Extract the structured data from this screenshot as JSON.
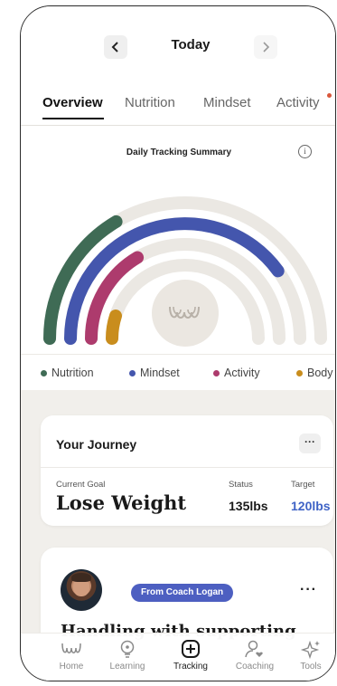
{
  "date_nav": {
    "title": "Today",
    "prev_icon": "chevron-left",
    "next_icon": "chevron-right"
  },
  "tabs": [
    {
      "label": "Overview",
      "active": true
    },
    {
      "label": "Nutrition",
      "active": false
    },
    {
      "label": "Mindset",
      "active": false
    },
    {
      "label": "Activity",
      "active": false,
      "notification_dot": true
    }
  ],
  "summary": {
    "title": "Daily Tracking Summary",
    "info_icon": "info-icon",
    "rings": [
      {
        "name": "Nutrition",
        "color": "#3f6b55",
        "progress": 0.33
      },
      {
        "name": "Mindset",
        "color": "#4456ad",
        "progress": 0.8
      },
      {
        "name": "Activity",
        "color": "#ad3b6d",
        "progress": 0.33
      },
      {
        "name": "Body",
        "color": "#c98d1d",
        "progress": 0.1
      }
    ],
    "track_color": "#ebe8e3",
    "legend": [
      {
        "label": "Nutrition",
        "color": "#3f6b55"
      },
      {
        "label": "Mindset",
        "color": "#4456ad"
      },
      {
        "label": "Activity",
        "color": "#ad3b6d"
      },
      {
        "label": "Body",
        "color": "#c98d1d"
      }
    ]
  },
  "journey": {
    "title": "Your Journey",
    "more_icon": "more-icon",
    "goal_label": "Current Goal",
    "goal_value": "Lose Weight",
    "status_label": "Status",
    "status_value": "135lbs",
    "target_label": "Target",
    "target_value": "120lbs"
  },
  "coach_card": {
    "badge": "From Coach Logan",
    "headline": "Handling with supporting"
  },
  "bottom_nav": [
    {
      "label": "Home",
      "icon": "home-logo-icon",
      "active": false
    },
    {
      "label": "Learning",
      "icon": "lightbulb-icon",
      "active": false
    },
    {
      "label": "Tracking",
      "icon": "plus-square-icon",
      "active": true
    },
    {
      "label": "Coaching",
      "icon": "person-heart-icon",
      "active": false
    },
    {
      "label": "Tools",
      "icon": "sparkle-icon",
      "active": false
    }
  ]
}
